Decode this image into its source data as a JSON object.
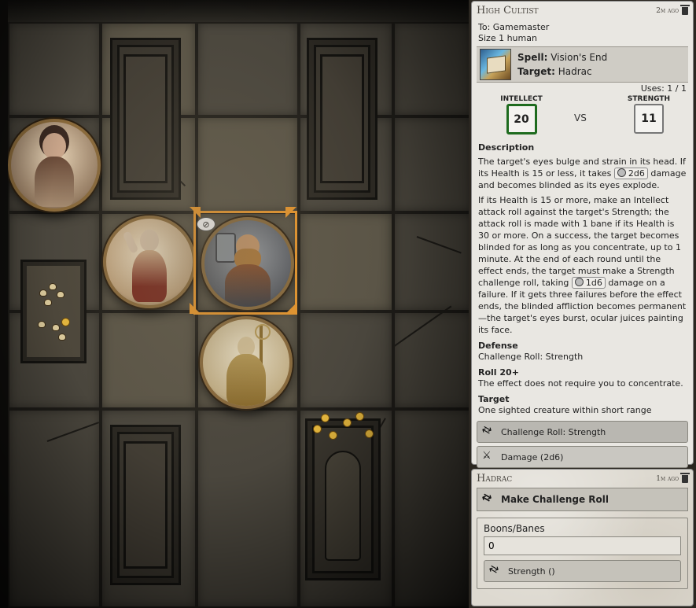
{
  "map": {
    "tokens": [
      {
        "name": "female-warrior",
        "colors": [
          "#6a4a38",
          "#c9a58a",
          "#3b2a22"
        ]
      },
      {
        "name": "bald-cultist",
        "colors": [
          "#7a2a1e",
          "#d4bfa5",
          "#caa884"
        ]
      },
      {
        "name": "dwarf-warrior",
        "colors": [
          "#3a3d45",
          "#b07a3a",
          "#8a4e2a"
        ]
      },
      {
        "name": "priest-staff",
        "colors": [
          "#8a6a2a",
          "#d8c49a",
          "#b89a55"
        ]
      }
    ]
  },
  "chat": {
    "message1": {
      "speaker": "High Cultist",
      "time": "2m ago",
      "to": "To: Gamemaster",
      "size": "Size 1 human",
      "spell_label": "Spell:",
      "spell_value": "Vision's End",
      "target_label": "Target:",
      "target_value": "Hadrac",
      "uses": "Uses: 1 / 1",
      "attack_attr": "Intellect",
      "attack_value": "20",
      "vs": "VS",
      "defense_attr": "Strength",
      "defense_value": "11",
      "description_heading": "Description",
      "desc_p1_a": "The target's eyes bulge and strain in its head. If its Health is 15 or less, it takes",
      "desc_p1_dice": "2d6",
      "desc_p1_b": "damage and becomes blinded as its eyes explode.",
      "desc_p2_a": "If its Health is 15 or more, make an Intellect attack roll against the target's Strength; the attack roll is made with 1 bane if its Health is 30 or more. On a success, the target becomes blinded for as long as you concentrate, up to 1 minute. At the end of each round until the effect ends, the target must make a Strength challenge roll, taking",
      "desc_p2_dice": "1d6",
      "desc_p2_b": "damage on a failure. If it gets three failures before the effect ends, the blinded affliction becomes permanent—the target's eyes burst, ocular juices painting its face.",
      "defense_heading": "Defense",
      "defense_text": "Challenge Roll: Strength",
      "roll20_heading": "Roll 20+",
      "roll20_text": "The effect does not require you to concentrate.",
      "target_heading": "Target",
      "target_text": "One sighted creature within short range",
      "btn_challenge": "Challenge Roll: Strength",
      "btn_damage": "Damage (2d6)"
    },
    "message2": {
      "speaker": "Hadrac",
      "time": "1m ago",
      "header": "Make Challenge Roll",
      "boons_label": "Boons/Banes",
      "boons_value": "0",
      "roll_button": "Strength ()"
    }
  }
}
